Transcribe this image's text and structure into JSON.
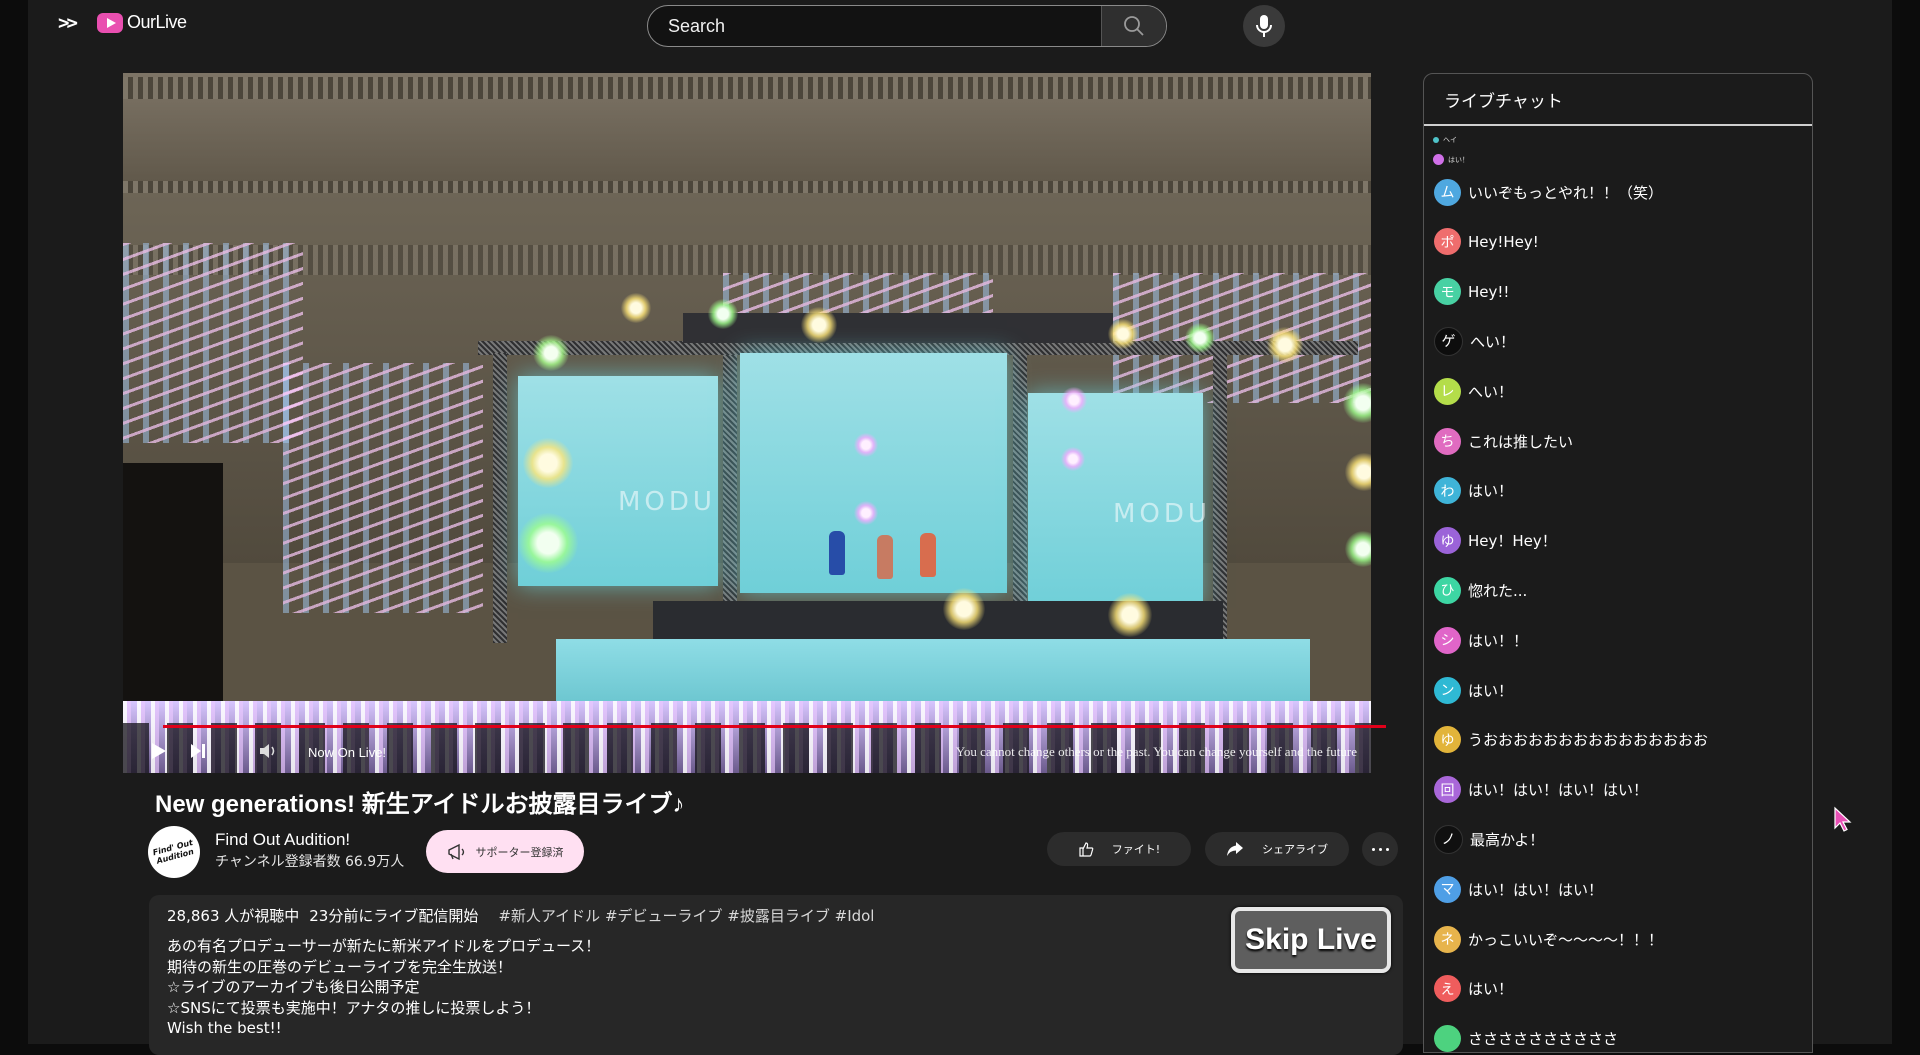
{
  "header": {
    "menu_label": ">>",
    "logo_text": "OurLive",
    "search_placeholder": "Search"
  },
  "video": {
    "screen_text": "MODU",
    "live_label": "Now On Live!",
    "motto": "You cannot change others or the past. You can change yourself and the future",
    "title": "New generations! 新生アイドルお披露目ライブ♪"
  },
  "channel": {
    "avatar_text": "Find' Out Audition",
    "name": "Find Out Audition!",
    "subscribers": "チャンネル登録者数 66.9万人",
    "supporter_label": "サポーター登録済",
    "cheer_label": "ファイト!",
    "share_label": "シェアライブ"
  },
  "description": {
    "viewers": "28,863 人が視聴中",
    "started": "23分前にライブ配信開始",
    "tags": "#新人アイドル #デビューライブ #披露目ライブ #Idol",
    "lines": [
      "あの有名プロデューサーが新たに新米アイドルをプロデュース！",
      "期待の新生の圧巻のデビューライブを完全生放送！",
      "☆ライブのアーカイブも後日公開予定",
      "☆SNSにて投票も実施中！アナタの推しに投票しよう！",
      "Wish the best!!"
    ],
    "skip_label": "Skip Live"
  },
  "chat": {
    "title": "ライブチャット",
    "tiny_messages": [
      {
        "text": "ヘイ",
        "color": "#4fc3c9"
      },
      {
        "text": "はい！",
        "color": "#d070e8"
      }
    ],
    "messages": [
      {
        "initial": "ム",
        "text": "いいぞもっとやれ！！（笑）",
        "color": "#4fa8e0"
      },
      {
        "initial": "ポ",
        "text": "Hey!Hey!",
        "color": "#ef6d6d"
      },
      {
        "initial": "モ",
        "text": "Hey!!",
        "color": "#48d1a3"
      },
      {
        "initial": "ゲ",
        "text": "へい！",
        "color": "#0d0d0d"
      },
      {
        "initial": "レ",
        "text": "へい！",
        "color": "#b4dd4a"
      },
      {
        "initial": "ち",
        "text": "これは推したい",
        "color": "#e06bc0"
      },
      {
        "initial": "わ",
        "text": "はい！",
        "color": "#3fb4d8"
      },
      {
        "initial": "ゆ",
        "text": "Hey！Hey！",
        "color": "#9b63d8"
      },
      {
        "initial": "ひ",
        "text": "惚れた...",
        "color": "#3dd6a3"
      },
      {
        "initial": "シ",
        "text": "はい！！",
        "color": "#e065c9"
      },
      {
        "initial": "ン",
        "text": "はい！",
        "color": "#2fb9d4"
      },
      {
        "initial": "ゆ",
        "text": "うおおおおおおおおおおおおおおお",
        "color": "#e2b43a"
      },
      {
        "initial": "回",
        "text": "はい！はい！はい！はい！",
        "color": "#a967d9"
      },
      {
        "initial": "ノ",
        "text": "最高かよ！",
        "color": "#101010"
      },
      {
        "initial": "マ",
        "text": "はい！はい！はい！",
        "color": "#4f9fe6"
      },
      {
        "initial": "ネ",
        "text": "かっこいいぞ～～～～！！！",
        "color": "#e7b44c"
      },
      {
        "initial": "え",
        "text": "はい！",
        "color": "#ef5d5d"
      },
      {
        "initial": "",
        "text": "ささささささささささ",
        "color": "#4dd27f"
      }
    ]
  },
  "colors": {
    "progress": "#e0001a",
    "brand_pink": "#e94fb0",
    "supporter_bg": "#ffe0f2"
  },
  "icons": [
    "menu-icon",
    "play-logo-icon",
    "search-icon",
    "microphone-icon",
    "play-icon",
    "next-icon",
    "volume-icon",
    "megaphone-icon",
    "thumbs-up-icon",
    "share-arrow-icon",
    "more-dots-icon",
    "cursor-icon"
  ]
}
